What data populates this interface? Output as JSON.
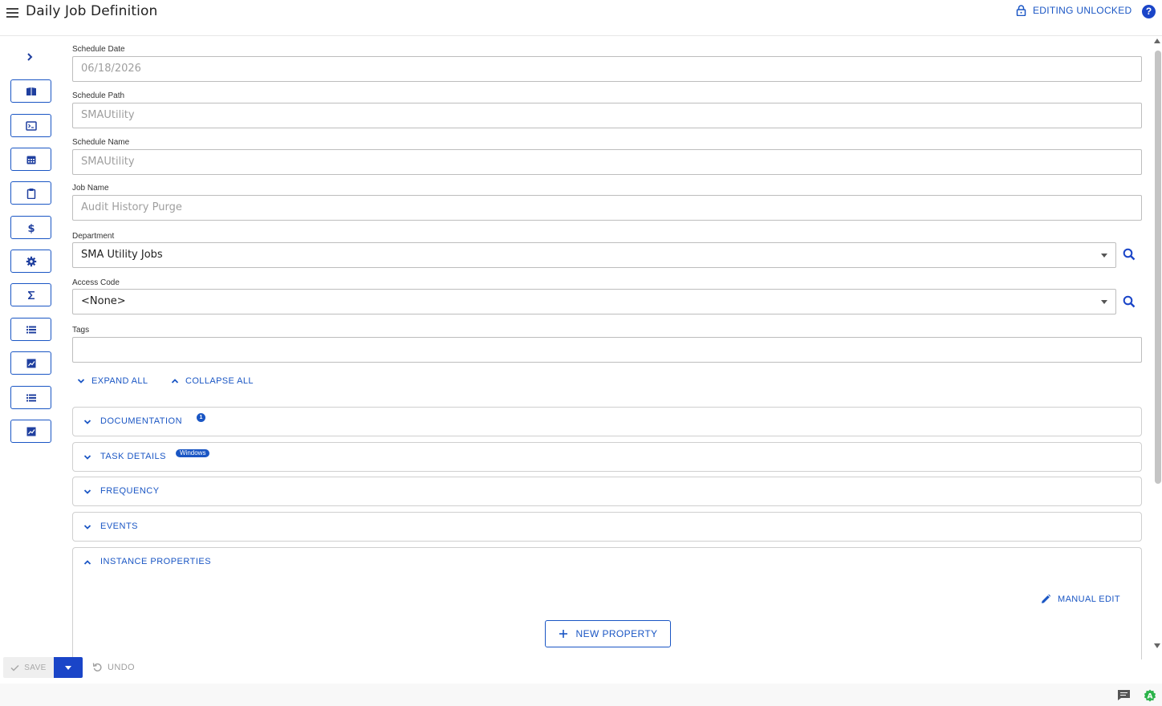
{
  "header": {
    "title": "Daily Job Definition",
    "lock_status": "EDITING UNLOCKED",
    "help_label": "?"
  },
  "form": {
    "schedule_date": {
      "label": "Schedule Date",
      "value": "06/18/2026"
    },
    "schedule_path": {
      "label": "Schedule Path",
      "value": "SMAUtility"
    },
    "schedule_name": {
      "label": "Schedule Name",
      "value": "SMAUtility"
    },
    "job_name": {
      "label": "Job Name",
      "value": "Audit History Purge"
    },
    "department": {
      "label": "Department",
      "value": "SMA Utility Jobs"
    },
    "access_code": {
      "label": "Access Code",
      "value": "<None>"
    },
    "tags": {
      "label": "Tags",
      "value": ""
    }
  },
  "section_controls": {
    "expand_all": "EXPAND ALL",
    "collapse_all": "COLLAPSE ALL"
  },
  "panels": {
    "documentation": {
      "title": "DOCUMENTATION",
      "badge": "1"
    },
    "task_details": {
      "title": "TASK DETAILS",
      "badge": "Windows"
    },
    "frequency": {
      "title": "FREQUENCY"
    },
    "events": {
      "title": "EVENTS"
    },
    "instance_properties": {
      "title": "INSTANCE PROPERTIES",
      "manual_edit": "MANUAL EDIT",
      "new_property": "NEW PROPERTY"
    }
  },
  "actions": {
    "save": "SAVE",
    "undo": "UNDO"
  },
  "rail_icons": [
    "book-icon",
    "terminal-icon",
    "calendar-icon",
    "clipboard-icon",
    "dollar-icon",
    "gear-icon",
    "sigma-icon",
    "list-icon",
    "chart-icon",
    "list-icon",
    "chart-icon"
  ],
  "colors": {
    "accent": "#1a56c4",
    "primary_button": "#1a45c8",
    "app_badge": "#2bb34a"
  }
}
